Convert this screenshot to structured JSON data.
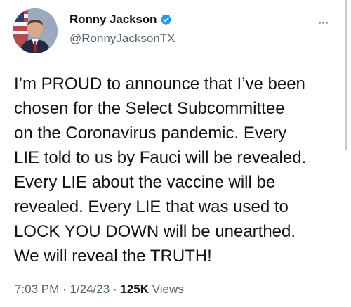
{
  "author": {
    "name": "Ronny Jackson",
    "handle": "@RonnyJacksonTX",
    "verified_color": "#1d9bf0"
  },
  "tweet": {
    "text": "I’m PROUD to announce that I’ve been\nchosen for the Select Subcommittee\non the Coronavirus pandemic. Every\nLIE told to us by Fauci will be revealed.\nEvery LIE about the vaccine will be\nrevealed. Every LIE that was used to\nLOCK YOU DOWN will be unearthed.\nWe will reveal the TRUTH!"
  },
  "meta": {
    "time": "7:03 PM",
    "separator": "·",
    "date": "1/24/23",
    "views_count": "125K",
    "views_label": "Views"
  },
  "icons": {
    "more": "more-options-icon",
    "verified": "verified-badge-icon"
  }
}
